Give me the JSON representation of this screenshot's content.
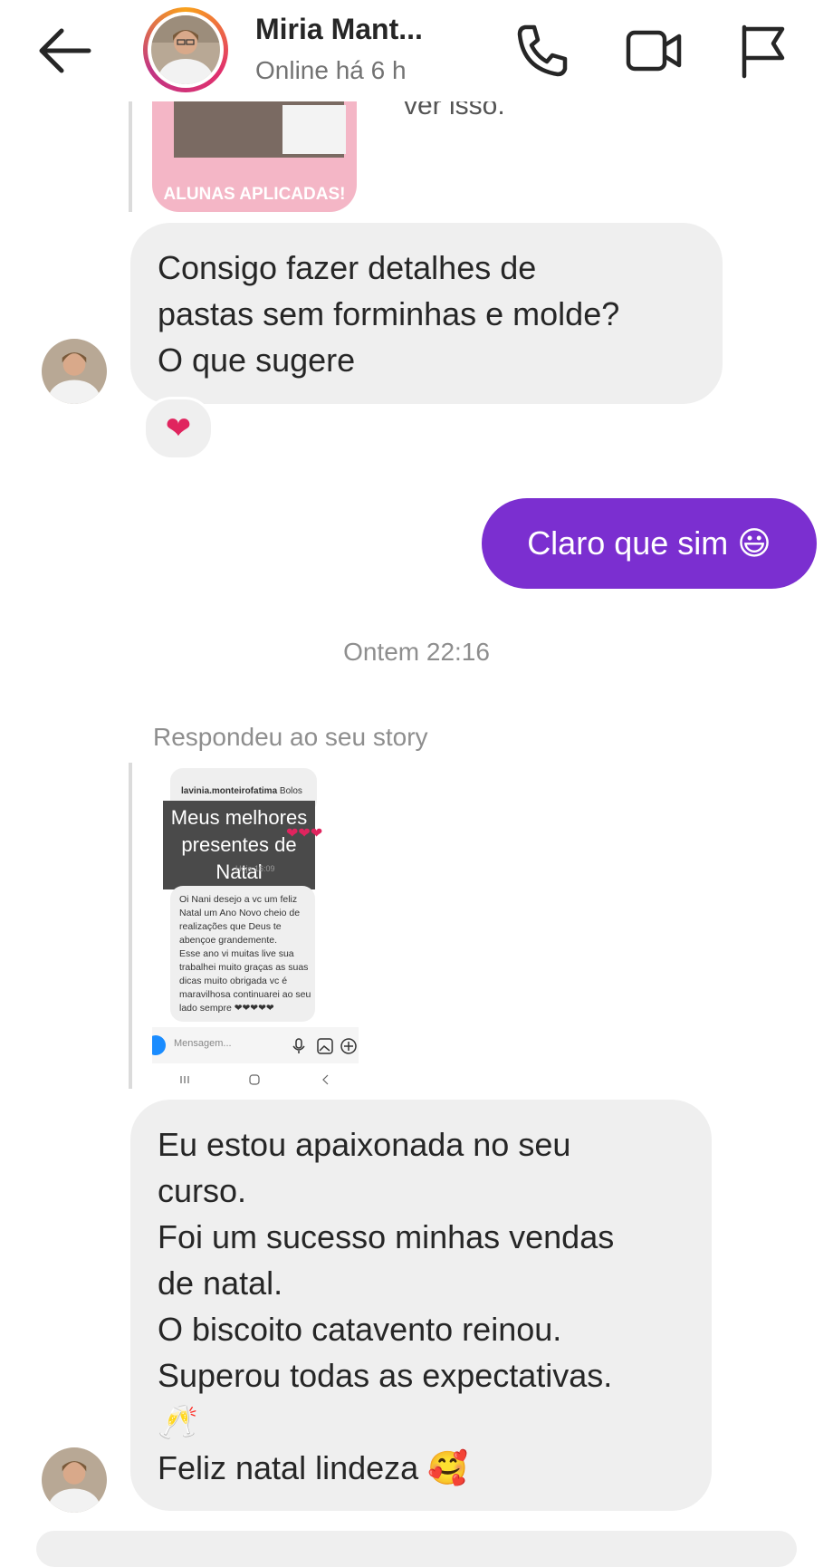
{
  "header": {
    "back_label": "back",
    "contact_name": "Miria Mant...",
    "status": "Online há 6 h",
    "icons": [
      "arrow-left-icon",
      "phone-icon",
      "video-icon",
      "flag-icon"
    ]
  },
  "thread": {
    "top_story_caption": "ALUNAS APLICADAS!",
    "top_cut_text": "ver isso.",
    "message1": "Consigo fazer detalhes de\npastas sem forminhas e molde?\nO que sugere",
    "reaction": "❤",
    "message_out": "Claro que sim 😃",
    "timestamp": "Ontem 22:16",
    "replied_label": "Respondeu ao seu story",
    "story_preview": {
      "username": "lavinia.monteirofatima",
      "username_caption": "Bolos",
      "label": "Meus melhores presentes de Natal",
      "time": "Hoje 16:09",
      "message": "Oi Nani desejo a vc um feliz Natal um Ano Novo cheio de realizações que Deus te abençoe grandemente.\nEsse ano vi muitas live sua trabalhei muito graças as suas dicas muito obrigada vc é maravilhosa continuarei ao seu lado sempre ❤❤❤❤❤",
      "input_placeholder": "Mensagem..."
    },
    "message2": "Eu estou apaixonada no seu\ncurso.\nFoi um sucesso minhas vendas\nde natal.\nO biscoito catavento reinou.\nSuperou todas as expectativas.\n🥂\nFeliz natal lindeza 🥰"
  },
  "colors": {
    "outgoing_bubble": "#7b2fd0",
    "incoming_bubble": "#efefef",
    "story_ring_start": "#f9a21b",
    "story_ring_end": "#c13584"
  }
}
